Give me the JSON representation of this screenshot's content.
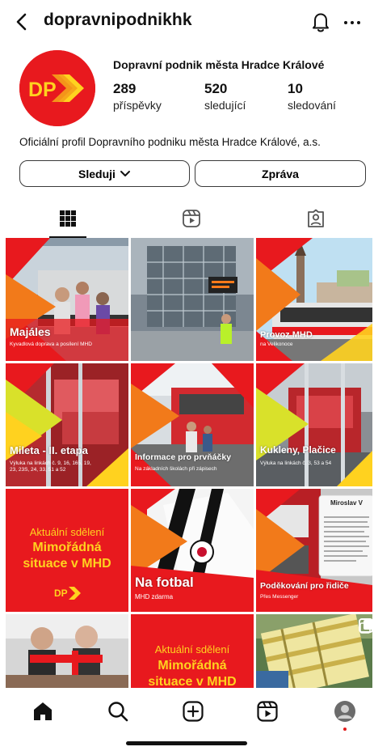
{
  "header": {
    "username": "dopravnipodnikhk"
  },
  "profile": {
    "full_name": "Dopravní podnik města Hradce Králové",
    "avatar_text": "DP",
    "stats": [
      {
        "value": "289",
        "label": "příspěvky"
      },
      {
        "value": "520",
        "label": "sledující"
      },
      {
        "value": "10",
        "label": "sledování"
      }
    ],
    "bio": "Oficiální profil Dopravního podniku města Hradce Králové, a.s."
  },
  "actions": {
    "follow_label": "Sleduji",
    "message_label": "Zpráva"
  },
  "posts": [
    {
      "title": "Majáles",
      "subtitle": "Kyvadlová doprava a posílení MHD"
    },
    {
      "title": "",
      "subtitle": ""
    },
    {
      "title": "Provoz MHD",
      "subtitle": "na Velikonoce"
    },
    {
      "title": "Mileta - II. etapa",
      "subtitle": "Výluka na linkách č. 9, 16, 165, 19,",
      "subtitle2": "23, 23S, 24, 33, 51 a 52"
    },
    {
      "title": "Informace pro prvňáčky",
      "subtitle": "Na základních školách při zápisech"
    },
    {
      "title": "Kukleny, Plačice",
      "subtitle": "Výluka na linkách č. 3, 53 a 54"
    },
    {
      "notice_top": "Aktuální sdělení",
      "notice_line1": "Mimořádná",
      "notice_line2": "situace v MHD",
      "logo": "DP"
    },
    {
      "title": "Na fotbal",
      "subtitle": "MHD zdarma"
    },
    {
      "title": "Poděkování pro řidiče",
      "subtitle": "Přes Messenger",
      "message_author": "Miroslav V"
    },
    {
      "title": "",
      "subtitle": ""
    },
    {
      "notice_top": "Aktuální sdělení",
      "notice_line1": "Mimořádná",
      "notice_line2": "situace v MHD"
    },
    {
      "title": "",
      "subtitle": ""
    }
  ],
  "colors": {
    "brand_red": "#e8191e",
    "brand_yellow": "#ffd21f",
    "accent_orange": "#f27a1a"
  }
}
